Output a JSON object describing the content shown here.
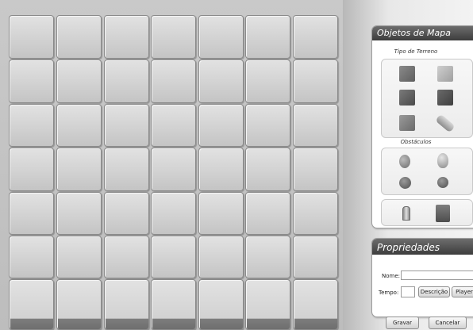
{
  "map": {
    "columns": 7,
    "rows": 7
  },
  "objects_panel": {
    "title": "Objetos de Mapa",
    "terrain_label": "Tipo de Terreno",
    "terrain_items": [
      "grass-tile",
      "sand-tile",
      "dark-grass-tile",
      "stone-tile",
      "light-grass-tile",
      "log"
    ],
    "obstacles_label": "Obstáculos",
    "obstacle_items": [
      "rock",
      "egg-rock",
      "bush",
      "shrub"
    ],
    "special_items": [
      "tower",
      "block"
    ]
  },
  "properties_panel": {
    "title": "Propriedades",
    "name_label": "Nome:",
    "name_value": "",
    "time_label": "Tempo:",
    "time_value": "",
    "description_button": "Descrição",
    "player_button": "Player"
  },
  "actions": {
    "save_label": "Gravar",
    "cancel_label": "Cancelar"
  }
}
